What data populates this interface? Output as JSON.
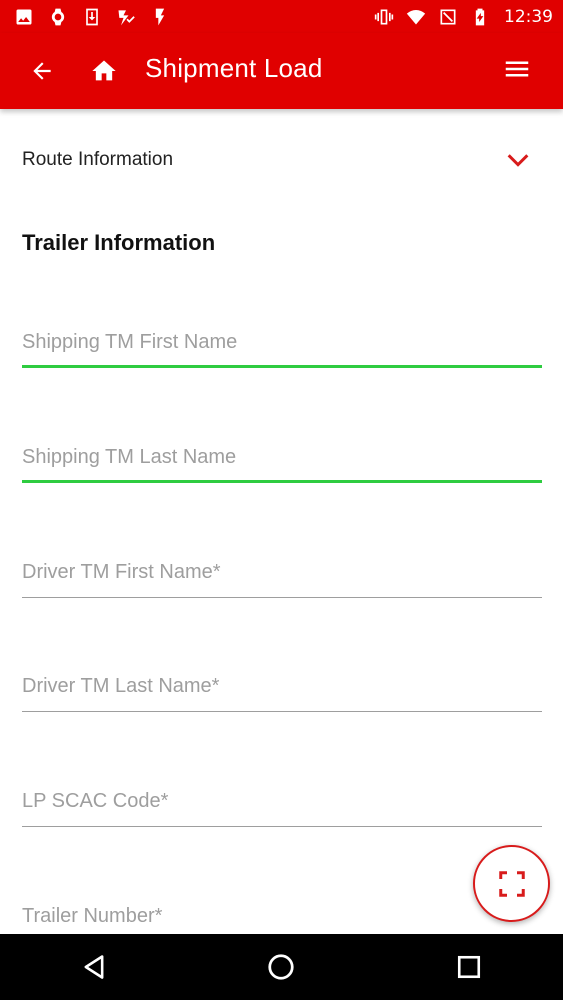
{
  "status_bar": {
    "time": "12:39",
    "icons_left": [
      "image-icon",
      "watch-icon",
      "download-icon",
      "check-badge-icon",
      "flash-icon"
    ],
    "icons_right": [
      "vibrate-icon",
      "wifi-icon",
      "no-sim-icon",
      "battery-charging-icon"
    ]
  },
  "app_bar": {
    "title": "Shipment Load",
    "icons": [
      "back-arrow-icon",
      "home-icon",
      "hamburger-menu-icon"
    ]
  },
  "route": {
    "label": "Route Information",
    "icon": "chevron-down-icon"
  },
  "trailer": {
    "title": "Trailer Information",
    "fields": [
      {
        "placeholder": "Shipping TM First Name",
        "value": ""
      },
      {
        "placeholder": "Shipping TM Last Name",
        "value": ""
      },
      {
        "placeholder": "Driver TM First Name*",
        "value": ""
      },
      {
        "placeholder": "Driver TM Last Name*",
        "value": ""
      },
      {
        "placeholder": "LP SCAC Code*",
        "value": ""
      },
      {
        "placeholder": "Trailer Number*",
        "value": ""
      }
    ]
  },
  "fab": {
    "icon": "scan-frame-icon"
  },
  "nav_bar": {
    "icons": [
      "nav-back-icon",
      "nav-home-icon",
      "nav-recents-icon"
    ]
  },
  "colors": {
    "primary": "#e00000",
    "active_underline": "#2ecc40",
    "placeholder": "#9e9e9e"
  }
}
